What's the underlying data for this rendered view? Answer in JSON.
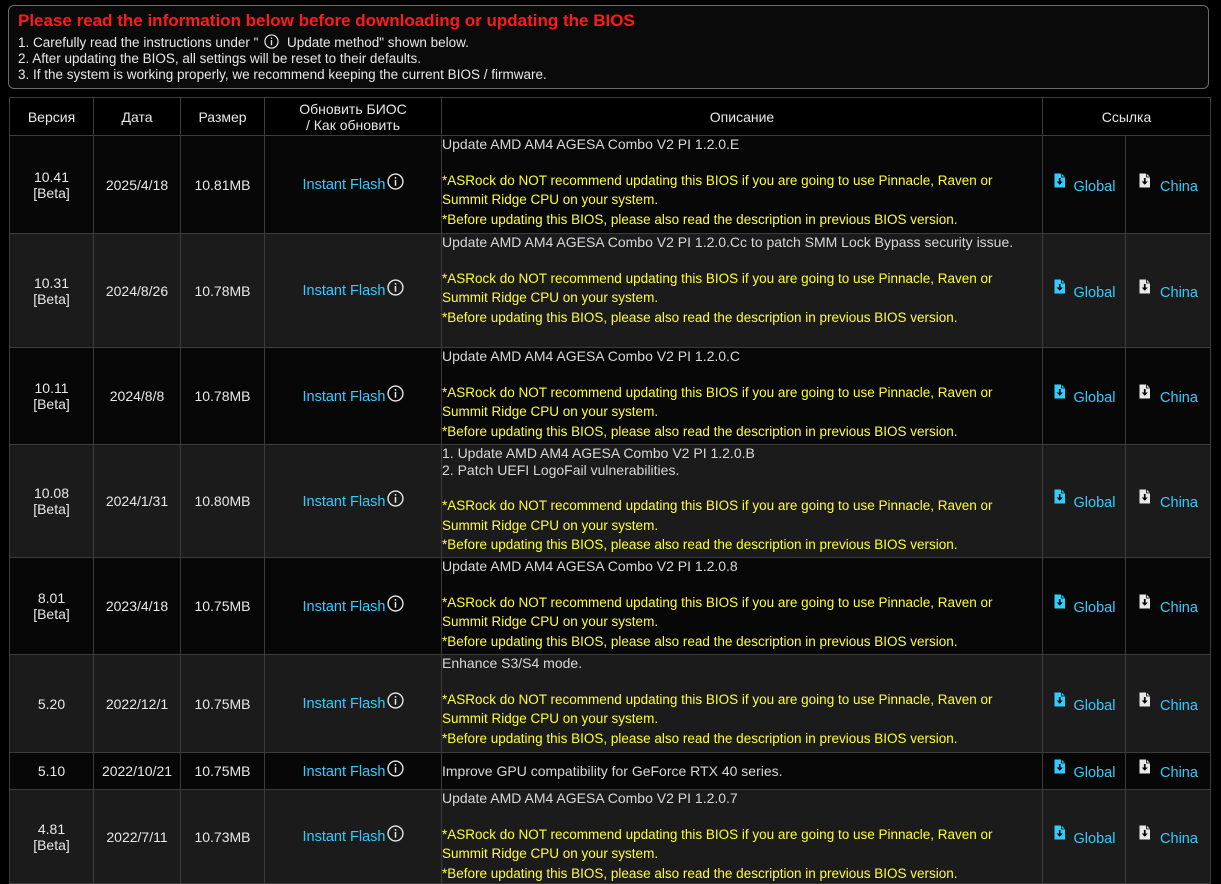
{
  "notice": {
    "title": "Please read the information below before downloading or updating the BIOS",
    "line1_pre": "1. Carefully read the instructions under \"",
    "line1_post": "Update method\" shown below.",
    "line2": "2. After updating the BIOS, all settings will be reset to their defaults.",
    "line3": "3. If the system is working properly, we recommend keeping the current BIOS / firmware."
  },
  "table": {
    "headers": {
      "version": "Версия",
      "date": "Дата",
      "size": "Размер",
      "update_l1": "Обновить БИОС",
      "update_l2": "/ Как обновить",
      "description": "Описание",
      "link": "Ссылка"
    },
    "flash_label": "Instant Flash",
    "global_label": "Global",
    "china_label": "China",
    "warning1": "*ASRock do NOT recommend updating this BIOS if you are going to use Pinnacle, Raven or Summit Ridge CPU on your system.",
    "warning2": "*Before updating this BIOS, please also read the description in previous BIOS version.",
    "rows": [
      {
        "version": "10.41",
        "tag": "[Beta]",
        "date": "2025/4/18",
        "size": "10.81MB",
        "desc": [
          "Update AMD AM4 AGESA Combo V2 PI 1.2.0.E"
        ]
      },
      {
        "version": "10.31",
        "tag": "[Beta]",
        "date": "2024/8/26",
        "size": "10.78MB",
        "desc": [
          "Update AMD AM4 AGESA Combo V2 PI 1.2.0.Cc to patch SMM Lock Bypass security issue."
        ]
      },
      {
        "version": "10.11",
        "tag": "[Beta]",
        "date": "2024/8/8",
        "size": "10.78MB",
        "desc": [
          "Update AMD AM4 AGESA Combo V2 PI 1.2.0.C"
        ]
      },
      {
        "version": "10.08",
        "tag": "[Beta]",
        "date": "2024/1/31",
        "size": "10.80MB",
        "desc": [
          "1. Update AMD AM4 AGESA Combo V2 PI 1.2.0.B",
          "2. Patch UEFI LogoFail vulnerabilities."
        ]
      },
      {
        "version": "8.01",
        "tag": "[Beta]",
        "date": "2023/4/18",
        "size": "10.75MB",
        "desc": [
          "Update AMD AM4 AGESA Combo V2 PI 1.2.0.8"
        ]
      },
      {
        "version": "5.20",
        "tag": "",
        "date": "2022/12/1",
        "size": "10.75MB",
        "desc": [
          "Enhance S3/S4 mode."
        ]
      },
      {
        "version": "5.10",
        "tag": "",
        "date": "2022/10/21",
        "size": "10.75MB",
        "desc": [
          "Improve GPU compatibility for GeForce RTX 40 series."
        ],
        "short": true
      },
      {
        "version": "4.81",
        "tag": "[Beta]",
        "date": "2022/7/11",
        "size": "10.73MB",
        "desc": [
          "Update AMD AM4 AGESA Combo V2 PI 1.2.0.7"
        ]
      }
    ]
  },
  "colors": {
    "title_red": "#ff1a1a",
    "link_cyan": "#33ccff",
    "warning_yellow": "#ffff33",
    "row_dark": "#070707",
    "row_light": "#1b1b1b"
  },
  "icons": {
    "info": "info-circle-icon",
    "global_download": "file-download-icon",
    "china_download": "file-download-icon"
  }
}
